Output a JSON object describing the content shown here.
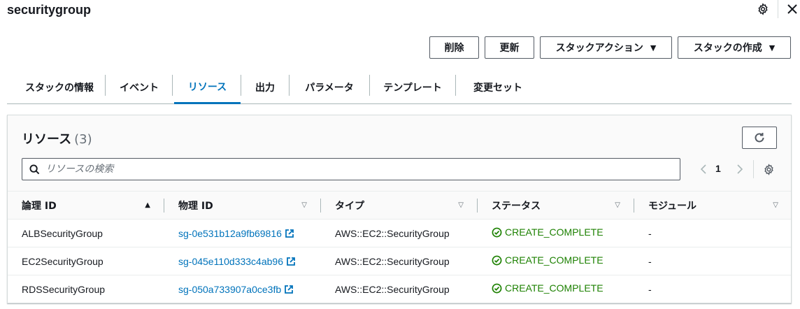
{
  "header": {
    "title": "securitygroup"
  },
  "actions": {
    "delete_label": "削除",
    "update_label": "更新",
    "stack_actions_label": "スタックアクション",
    "create_stack_label": "スタックの作成"
  },
  "tabs": [
    {
      "label": "スタックの情報",
      "active": false
    },
    {
      "label": "イベント",
      "active": false
    },
    {
      "label": "リソース",
      "active": true
    },
    {
      "label": "出力",
      "active": false
    },
    {
      "label": "パラメータ",
      "active": false
    },
    {
      "label": "テンプレート",
      "active": false
    },
    {
      "label": "変更セット",
      "active": false
    }
  ],
  "panel": {
    "title": "リソース",
    "count": "(3)",
    "search_placeholder": "リソースの検索",
    "page_number": "1"
  },
  "table": {
    "columns": [
      "論理 ID",
      "物理 ID",
      "タイプ",
      "ステータス",
      "モジュール"
    ],
    "rows": [
      {
        "logical_id": "ALBSecurityGroup",
        "physical_id": "sg-0e531b12a9fb69816",
        "type": "AWS::EC2::SecurityGroup",
        "status": "CREATE_COMPLETE",
        "module": "-"
      },
      {
        "logical_id": "EC2SecurityGroup",
        "physical_id": "sg-045e110d333c4ab96",
        "type": "AWS::EC2::SecurityGroup",
        "status": "CREATE_COMPLETE",
        "module": "-"
      },
      {
        "logical_id": "RDSSecurityGroup",
        "physical_id": "sg-050a733907a0ce3fb",
        "type": "AWS::EC2::SecurityGroup",
        "status": "CREATE_COMPLETE",
        "module": "-"
      }
    ]
  },
  "colors": {
    "link": "#0073bb",
    "success": "#1d8102",
    "text": "#16191f",
    "border": "#545b64"
  }
}
